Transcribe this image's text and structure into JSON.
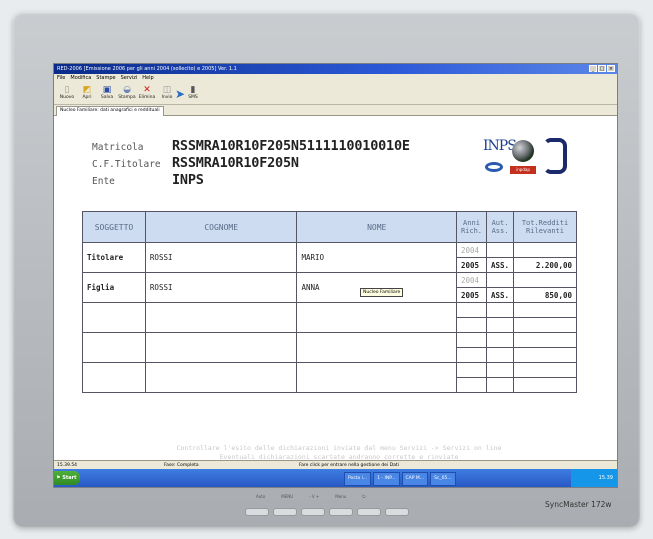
{
  "window": {
    "title": "RED-2006 [Emissione 2006 per gli anni 2004 (sollecito) e 2005] Ver. 1.1"
  },
  "menu": [
    "File",
    "Modifica",
    "Stampe",
    "Servizi",
    "Help"
  ],
  "toolbar": [
    {
      "label": "Nuovo",
      "icon": "new-file-icon"
    },
    {
      "label": "Apri",
      "icon": "open-folder-icon"
    },
    {
      "label": "Salva",
      "icon": "save-icon"
    },
    {
      "label": "Stampa",
      "icon": "print-icon"
    },
    {
      "label": "Elimina",
      "icon": "delete-icon"
    },
    {
      "label": "Invio",
      "icon": "send-icon"
    },
    {
      "label": "SMS",
      "icon": "sms-icon"
    }
  ],
  "tab": {
    "label": "Nucleo Familiare: dati anagrafici e reddituali"
  },
  "header": {
    "matricola_label": "Matricola",
    "matricola_value": "RSSMRA10R10F205N5111110010010E",
    "titolare_label": "C.F.Titolare",
    "titolare_value": "RSSMRA10R10F205N",
    "ente_label": "Ente",
    "ente_value": "INPS"
  },
  "logos": {
    "inps": "INPS",
    "inpdap": "inpdap"
  },
  "table": {
    "headers": {
      "soggetto": "SOGGETTO",
      "cognome": "COGNOME",
      "nome": "NOME",
      "anni_a": "Anni",
      "anni_b": "Rich.",
      "aut_a": "Aut.",
      "aut_b": "Ass.",
      "tot_a": "Tot.Redditi",
      "tot_b": "Rilevanti"
    },
    "rows": [
      {
        "soggetto": "Titolare",
        "cognome": "ROSSI",
        "nome": "MARIO",
        "year1": "2004",
        "year2": "2005",
        "aut": "ASS.",
        "reddito": "2.200,00"
      },
      {
        "soggetto": "Figlia",
        "cognome": "ROSSI",
        "nome": "ANNA",
        "year1": "2004",
        "year2": "2005",
        "aut": "ASS.",
        "reddito": "850,00"
      }
    ]
  },
  "tooltip": "Nucleo Familiare",
  "hint": {
    "line1": "Controllare l'esito delle dichiarazioni inviate dal menu Servizi -> Servizi on line",
    "line2": "Eventuali dichiarazioni scartate andranno corrette e rinviate"
  },
  "status": {
    "time": "15.39.54",
    "phase": "Fase: Completa",
    "message": "Fare click per entrare nella gestione dei Dati"
  },
  "taskbar": {
    "start": "Start",
    "tasks": [
      "Posta i...",
      "1 - INP...",
      "CAP M...",
      "Sc_05..."
    ],
    "clock": "15.39"
  },
  "monitor": {
    "brand": "SyncMaster 172w",
    "controls": [
      "Auto",
      "MENU",
      "- V +",
      "Menu",
      "⏻"
    ]
  }
}
